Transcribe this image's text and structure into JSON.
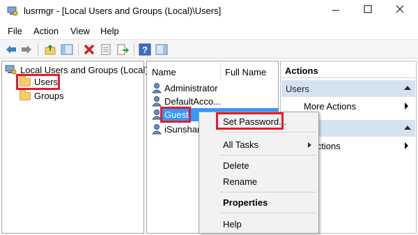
{
  "window": {
    "title": "lusrmgr - [Local Users and Groups (Local)\\Users]"
  },
  "menubar": {
    "items": [
      "File",
      "Action",
      "View",
      "Help"
    ]
  },
  "toolbar": {
    "icons": [
      "back-arrow-icon",
      "forward-arrow-icon",
      "up-folder-icon",
      "show-hide-tree-icon",
      "delete-icon",
      "properties-icon",
      "export-list-icon",
      "help-icon",
      "show-hide-action-pane-icon"
    ]
  },
  "tree": {
    "root_label": "Local Users and Groups (Local)",
    "items": [
      "Users",
      "Groups"
    ]
  },
  "list": {
    "columns": [
      "Name",
      "Full Name"
    ],
    "rows": [
      "Administrator",
      "DefaultAcco...",
      "Guest",
      "iSunshar"
    ]
  },
  "actions": {
    "title": "Actions",
    "groups": [
      {
        "label": "Users",
        "more": "More Actions"
      },
      {
        "label": "",
        "more": "e Actions"
      }
    ]
  },
  "context_menu": {
    "items": [
      "Set Password...",
      "All Tasks",
      "Delete",
      "Rename",
      "Properties",
      "Help"
    ]
  },
  "colors": {
    "selection": "#3399ff",
    "annotation": "#e8192c",
    "actions_group_bg": "#d5e3f1"
  }
}
